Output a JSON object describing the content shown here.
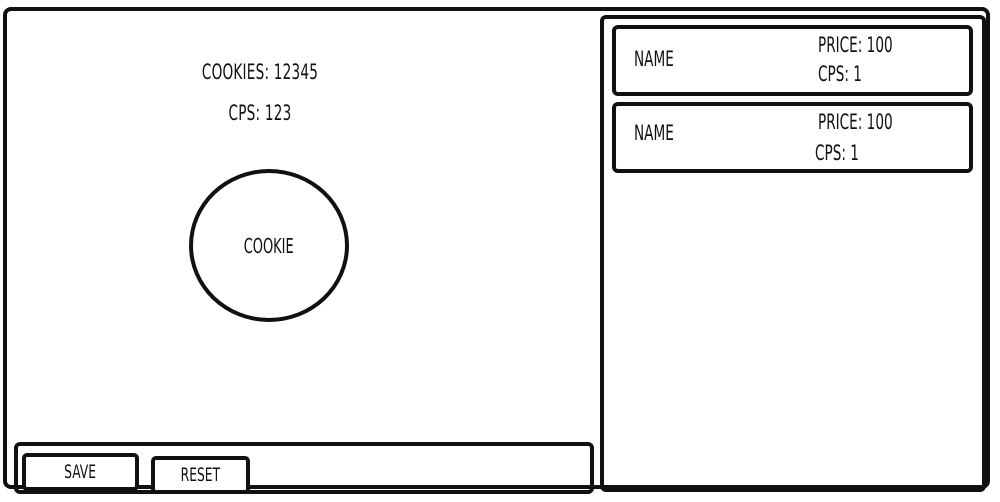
{
  "stats": {
    "cookies_label": "COOKIES: 12345",
    "cps_label": "CPS: 123"
  },
  "cookie_button": {
    "label": "COOKIE"
  },
  "footer": {
    "save_label": "SAVE",
    "reset_label": "RESET"
  },
  "shop": {
    "items": [
      {
        "name": "NAME",
        "price": "PRICE: 100",
        "cps": "CPS: 1"
      },
      {
        "name": "NAME",
        "price": "PRICE: 100",
        "cps": "CPS: 1"
      }
    ]
  }
}
